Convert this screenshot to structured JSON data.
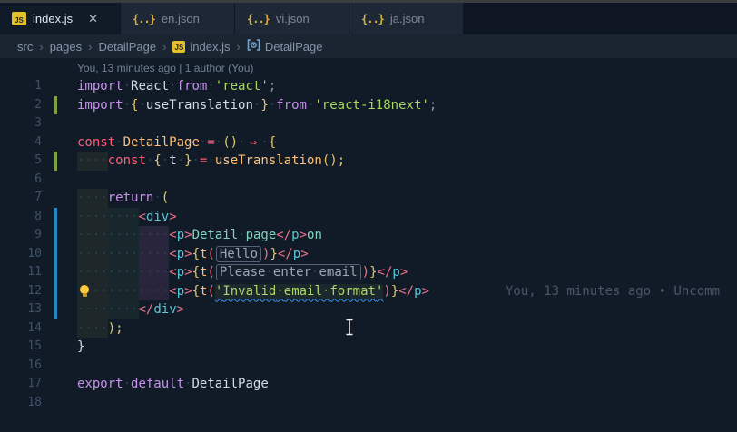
{
  "palette": {
    "topstrip": "#3b3c3e",
    "tabbarbg": "#0d1622",
    "tabinactivebg": "#1d2735",
    "tabinactivefg": "#7c8798",
    "tabactivefg": "#dfe5ee",
    "editorbg": "#111b28",
    "breadcrumbbg": "#1b2532",
    "breadcrumbfg": "#8695aa",
    "jsiconbg": "#e2c028",
    "jsoniconfg": "#d9b13c",
    "symbolblue": "#6aa9e0",
    "codelensfg": "#6f8192",
    "blamefg": "#4a5666",
    "lnfg": "#3e5166",
    "wsdot": "#2c3e52",
    "addedgreen": "#7fa13e",
    "modifiedblue": "#2188c4",
    "kwpurple": "#c792ea",
    "kwred": "#ff5c74",
    "idfg": "#d2dce8",
    "fngold": "#ffbe76",
    "strgreen": "#abd667",
    "punfg": "#8494a6",
    "bracketgold": "#e8c868",
    "parencoral": "#f07189",
    "tagcyan": "#56c8d8",
    "jsxteal": "#80d4c0",
    "boxfg": "#9aa6b6",
    "boxborder": "#566377",
    "bulbyellow": "#ffc83d",
    "wavyblue": "#3f96e0"
  },
  "tabs": {
    "items": [
      {
        "label": "index.js",
        "icon": "js",
        "active": true,
        "close_label": "✕"
      },
      {
        "label": "en.json",
        "icon": "json"
      },
      {
        "label": "vi.json",
        "icon": "json"
      },
      {
        "label": "ja.json",
        "icon": "json"
      }
    ]
  },
  "breadcrumb": {
    "separator": "›",
    "items": [
      "src",
      "pages",
      "DetailPage",
      "index.js",
      "DetailPage"
    ]
  },
  "editor": {
    "codelens": "You, 13 minutes ago | 1 author (You)",
    "inline_blame": "You, 13 minutes ago • Uncomm",
    "lines": [
      {
        "num": 1,
        "ind": 0,
        "tokens": [
          {
            "c": "kw",
            "t": "import"
          },
          {
            "c": "sp",
            "t": " "
          },
          {
            "c": "id",
            "t": "React"
          },
          {
            "c": "sp",
            "t": " "
          },
          {
            "c": "kw",
            "t": "from"
          },
          {
            "c": "sp",
            "t": " "
          },
          {
            "c": "str",
            "t": "'react'"
          },
          {
            "c": "pun",
            "t": ";"
          }
        ]
      },
      {
        "num": 2,
        "ind": 0,
        "gutter": "added",
        "tokens": [
          {
            "c": "kw",
            "t": "import"
          },
          {
            "c": "sp",
            "t": " "
          },
          {
            "c": "br",
            "t": "{"
          },
          {
            "c": "sp",
            "t": " "
          },
          {
            "c": "id",
            "t": "useTranslation"
          },
          {
            "c": "sp",
            "t": " "
          },
          {
            "c": "br",
            "t": "}"
          },
          {
            "c": "sp",
            "t": " "
          },
          {
            "c": "kw",
            "t": "from"
          },
          {
            "c": "sp",
            "t": " "
          },
          {
            "c": "str",
            "t": "'react-i18next'"
          },
          {
            "c": "pun",
            "t": ";"
          }
        ]
      },
      {
        "num": 3,
        "ind": 0,
        "tokens": []
      },
      {
        "num": 4,
        "ind": 0,
        "tokens": [
          {
            "c": "kw2",
            "t": "const"
          },
          {
            "c": "sp",
            "t": " "
          },
          {
            "c": "fn",
            "t": "DetailPage"
          },
          {
            "c": "sp",
            "t": " "
          },
          {
            "c": "op",
            "t": "="
          },
          {
            "c": "sp",
            "t": " "
          },
          {
            "c": "br",
            "t": "()"
          },
          {
            "c": "sp",
            "t": " "
          },
          {
            "c": "arrow",
            "t": "⇒"
          },
          {
            "c": "sp",
            "t": " "
          },
          {
            "c": "br",
            "t": "{"
          }
        ]
      },
      {
        "num": 5,
        "ind": 4,
        "gutter": "added",
        "tokens": [
          {
            "c": "kw2",
            "t": "const"
          },
          {
            "c": "sp",
            "t": " "
          },
          {
            "c": "br",
            "t": "{"
          },
          {
            "c": "sp",
            "t": " "
          },
          {
            "c": "id",
            "t": "t"
          },
          {
            "c": "sp",
            "t": " "
          },
          {
            "c": "br",
            "t": "}"
          },
          {
            "c": "sp",
            "t": " "
          },
          {
            "c": "op",
            "t": "="
          },
          {
            "c": "sp",
            "t": " "
          },
          {
            "c": "fn",
            "t": "useTranslation"
          },
          {
            "c": "br",
            "t": "();"
          }
        ]
      },
      {
        "num": 6,
        "ind": 0,
        "tokens": []
      },
      {
        "num": 7,
        "ind": 4,
        "tokens": [
          {
            "c": "kw",
            "t": "return"
          },
          {
            "c": "sp",
            "t": " "
          },
          {
            "c": "br",
            "t": "("
          }
        ]
      },
      {
        "num": 8,
        "ind": 8,
        "gutter": "modified",
        "tokens": [
          {
            "c": "tagb",
            "t": "<"
          },
          {
            "c": "tag",
            "t": "div"
          },
          {
            "c": "tagb",
            "t": ">"
          }
        ]
      },
      {
        "num": 9,
        "ind": 12,
        "gutter": "modified",
        "tokens": [
          {
            "c": "tagb",
            "t": "<"
          },
          {
            "c": "tag",
            "t": "p"
          },
          {
            "c": "tagb",
            "t": ">"
          },
          {
            "c": "jsx",
            "t": "Detail page"
          },
          {
            "c": "tagb",
            "t": "</"
          },
          {
            "c": "tag",
            "t": "p"
          },
          {
            "c": "tagb",
            "t": ">"
          },
          {
            "c": "jsx",
            "t": "on"
          }
        ]
      },
      {
        "num": 10,
        "ind": 12,
        "gutter": "modified",
        "tokens": [
          {
            "c": "tagb",
            "t": "<"
          },
          {
            "c": "tag",
            "t": "p"
          },
          {
            "c": "tagb",
            "t": ">"
          },
          {
            "c": "br",
            "t": "{"
          },
          {
            "c": "fn",
            "t": "t"
          },
          {
            "c": "par",
            "t": "("
          },
          {
            "c": "box",
            "t": "Hello"
          },
          {
            "c": "par",
            "t": ")"
          },
          {
            "c": "br",
            "t": "}"
          },
          {
            "c": "tagb",
            "t": "</"
          },
          {
            "c": "tag",
            "t": "p"
          },
          {
            "c": "tagb",
            "t": ">"
          }
        ]
      },
      {
        "num": 11,
        "ind": 12,
        "gutter": "modified",
        "tokens": [
          {
            "c": "tagb",
            "t": "<"
          },
          {
            "c": "tag",
            "t": "p"
          },
          {
            "c": "tagb",
            "t": ">"
          },
          {
            "c": "br",
            "t": "{"
          },
          {
            "c": "fn",
            "t": "t"
          },
          {
            "c": "par",
            "t": "("
          },
          {
            "c": "box",
            "t": "Please enter email"
          },
          {
            "c": "par",
            "t": ")"
          },
          {
            "c": "br",
            "t": "}"
          },
          {
            "c": "tagb",
            "t": "</"
          },
          {
            "c": "tag",
            "t": "p"
          },
          {
            "c": "tagb",
            "t": ">"
          }
        ]
      },
      {
        "num": 12,
        "ind": 12,
        "gutter": "modified",
        "bulb": true,
        "blame": true,
        "tokens": [
          {
            "c": "tagb",
            "t": "<"
          },
          {
            "c": "tag",
            "t": "p"
          },
          {
            "c": "tagb",
            "t": ">"
          },
          {
            "c": "br",
            "t": "{"
          },
          {
            "c": "fn",
            "t": "t"
          },
          {
            "c": "par",
            "t": "("
          },
          {
            "c": "stru",
            "t": "'Invalid email format'"
          },
          {
            "c": "par",
            "t": ")"
          },
          {
            "c": "br",
            "t": "}"
          },
          {
            "c": "tagb",
            "t": "</"
          },
          {
            "c": "tag",
            "t": "p"
          },
          {
            "c": "tagb",
            "t": ">"
          }
        ]
      },
      {
        "num": 13,
        "ind": 8,
        "gutter": "modified",
        "tokens": [
          {
            "c": "tagb",
            "t": "</"
          },
          {
            "c": "tag",
            "t": "div"
          },
          {
            "c": "tagb",
            "t": ">"
          }
        ]
      },
      {
        "num": 14,
        "ind": 4,
        "tokens": [
          {
            "c": "br",
            "t": ");"
          }
        ]
      },
      {
        "num": 15,
        "ind": 0,
        "tokens": [
          {
            "c": "id",
            "t": "}"
          }
        ]
      },
      {
        "num": 16,
        "ind": 0,
        "tokens": []
      },
      {
        "num": 17,
        "ind": 0,
        "tokens": [
          {
            "c": "kw",
            "t": "export"
          },
          {
            "c": "sp",
            "t": " "
          },
          {
            "c": "kw",
            "t": "default"
          },
          {
            "c": "sp",
            "t": " "
          },
          {
            "c": "id",
            "t": "DetailPage"
          }
        ]
      },
      {
        "num": 18,
        "ind": 0,
        "tokens": []
      }
    ]
  }
}
